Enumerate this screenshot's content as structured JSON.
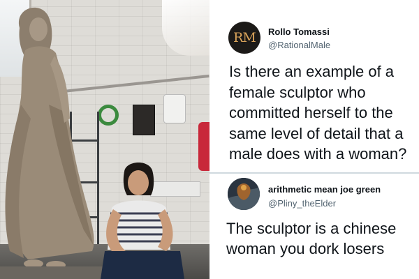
{
  "photo": {
    "alt_subject": "sculptor-with-statue"
  },
  "tweet_1": {
    "avatar_monogram": "RM",
    "display_name": "Rollo Tomassi",
    "handle": "@RationalMale",
    "text_lines": [
      "Is there an example of a",
      "female sculptor who",
      "committed herself to the",
      "same level of detail that a",
      "male does with a woman?"
    ]
  },
  "tweet_2": {
    "display_name": "arithmetic mean joe green",
    "handle": "@Pliny_theElder",
    "text_lines": [
      "The sculptor is a chinese",
      "woman you dork losers"
    ]
  },
  "colors": {
    "name_text": "#0f1419",
    "handle_text": "#536471",
    "divider": "#cfd9de",
    "monogram": "#d9a35a"
  }
}
